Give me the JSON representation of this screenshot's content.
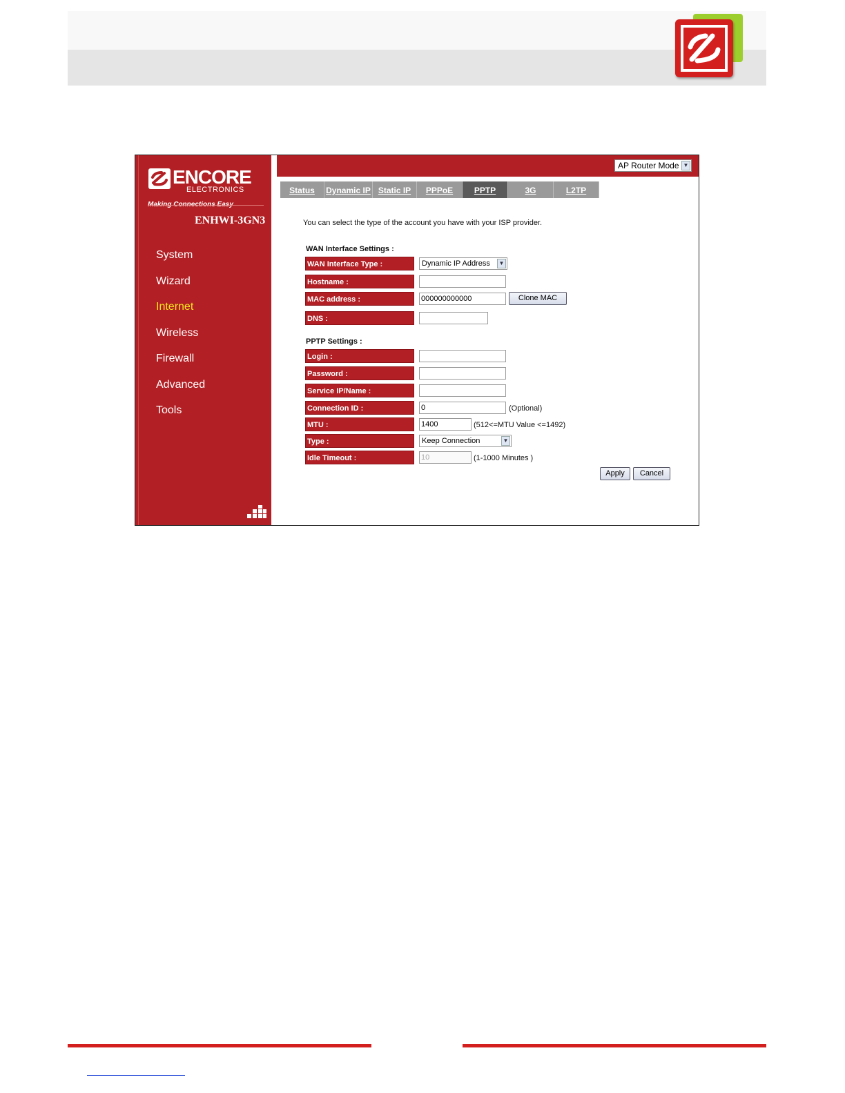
{
  "colors": {
    "brand_red": "#b21f24",
    "accent_green": "#9ccf2d",
    "active_nav": "#f2e51e"
  },
  "logo": {
    "brand": "ENCORE",
    "sub": "ELECTRONICS",
    "tagline": "Making Connections Easy"
  },
  "model": "ENHWI-3GN3",
  "nav": [
    "System",
    "Wizard",
    "Internet",
    "Wireless",
    "Firewall",
    "Advanced",
    "Tools"
  ],
  "nav_active": "Internet",
  "mode_select": {
    "value": "AP Router Mode"
  },
  "tabs": [
    "Status",
    "Dynamic IP",
    "Static IP",
    "PPPoE",
    "PPTP",
    "3G",
    "L2TP"
  ],
  "tab_active": "PPTP",
  "intro": "You can select the type of the account you have with your ISP provider.",
  "wan": {
    "title": "WAN Interface Settings :",
    "type_label": "WAN Interface Type :",
    "type_value": "Dynamic IP Address",
    "hostname_label": "Hostname :",
    "hostname_value": "",
    "mac_label": "MAC address :",
    "mac_value": "000000000000",
    "clone_mac": "Clone MAC",
    "dns_label": "DNS :",
    "dns_value": ""
  },
  "pptp": {
    "title": "PPTP Settings :",
    "login_label": "Login :",
    "password_label": "Password :",
    "service_label": "Service IP/Name :",
    "connid_label": "Connection ID :",
    "connid_value": "0",
    "connid_hint": "(Optional)",
    "mtu_label": "MTU :",
    "mtu_value": "1400",
    "mtu_hint": "(512<=MTU Value <=1492)",
    "type_label": "Type :",
    "type_value": "Keep Connection",
    "idle_label": "Idle Timeout :",
    "idle_value": "10",
    "idle_hint": "(1-1000 Minutes )"
  },
  "buttons": {
    "apply": "Apply",
    "cancel": "Cancel"
  },
  "icons": [
    "encore-logo-icon",
    "grid-icon",
    "dropdown-arrow-icon"
  ]
}
